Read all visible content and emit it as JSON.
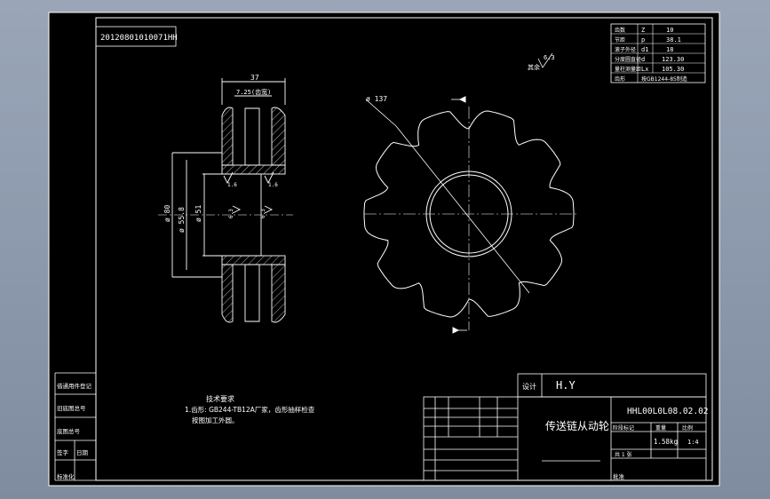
{
  "drawing": {
    "stamp_code": "20120801010071HH",
    "title_block": {
      "designer_label": "设计",
      "designer_value": "H.Y",
      "part_name": "传送链从动轮",
      "drawing_number": "HHL00L0L08.02.02",
      "weight": "1.58kg",
      "scale": "1:4",
      "stage_label": "阶段标记",
      "weight_label": "重量",
      "scale_label": "比例",
      "sheet_info": "共 1 张",
      "footer_left": "标准化",
      "footer_right": "批准"
    },
    "left_strip": [
      "借通用件登记",
      "旧底图总号",
      "底图总号",
      "签字",
      "日期"
    ],
    "parameter_table": {
      "rows": [
        {
          "name": "齿数",
          "symbol": "Z",
          "value": "10"
        },
        {
          "name": "节距",
          "symbol": "p",
          "value": "38.1"
        },
        {
          "name": "滚子外径",
          "symbol": "d1",
          "value": "18"
        },
        {
          "name": "分度圆直径",
          "symbol": "d",
          "value": "123.30"
        },
        {
          "name": "量柱测量距",
          "symbol": "Lx",
          "value": "105.30"
        },
        {
          "name": "齿形",
          "symbol": "",
          "value": "按GB1244-85制造"
        }
      ]
    },
    "tech_requirements": {
      "title": "技术要求",
      "lines": [
        "1.齿形: GB244-TB12A厂家，齿形抽样检查",
        "按图加工外圆。"
      ]
    },
    "dimensions": {
      "width_total": "37",
      "groove": "7.25(齿宽)",
      "dia_outer_hub": "ø 80",
      "dia_bore_a": "ø 55.8",
      "dia_bore_b": "ø 51",
      "dia_sprocket": "ø 137",
      "rough_a": "1.6",
      "rough_b": "1.6",
      "rough_c": "6.3",
      "rough_d": "6.3",
      "rough_e": "6.3",
      "rough_corner": "其余"
    }
  }
}
